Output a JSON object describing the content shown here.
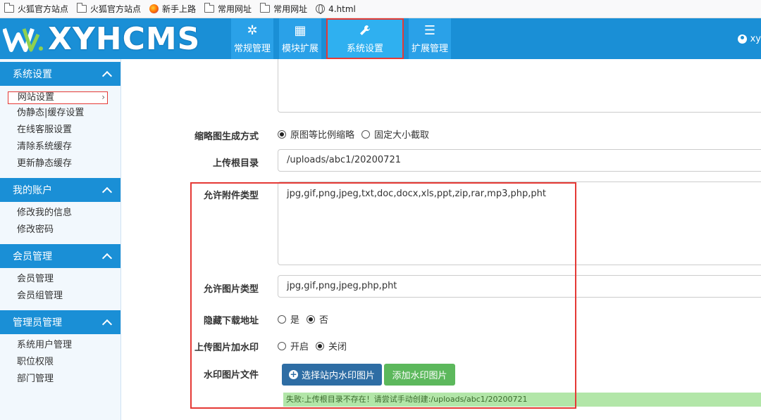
{
  "bookmarks": [
    {
      "label": "火狐官方站点",
      "icon": "folder-icon"
    },
    {
      "label": "火狐官方站点",
      "icon": "folder-icon"
    },
    {
      "label": "新手上路",
      "icon": "firefox-icon"
    },
    {
      "label": "常用网址",
      "icon": "folder-icon"
    },
    {
      "label": "常用网址",
      "icon": "folder-icon"
    },
    {
      "label": "4.html",
      "icon": "globe-icon"
    }
  ],
  "header": {
    "logo_text": "XYHCMS",
    "tabs": [
      {
        "label": "常规管理",
        "icon": "snowflake-icon"
      },
      {
        "label": "模块扩展",
        "icon": "grid-icon"
      },
      {
        "label": "系统设置",
        "icon": "wrench-icon"
      },
      {
        "label": "扩展管理",
        "icon": "list-icon"
      }
    ],
    "user": "xy"
  },
  "sidebar": {
    "sections": [
      {
        "title": "系统设置",
        "items": [
          "网站设置",
          "伪静态|缓存设置",
          "在线客服设置",
          "清除系统缓存",
          "更新静态缓存"
        ]
      },
      {
        "title": "我的账户",
        "items": [
          "修改我的信息",
          "修改密码"
        ]
      },
      {
        "title": "会员管理",
        "items": [
          "会员管理",
          "会员组管理"
        ]
      },
      {
        "title": "管理员管理",
        "items": [
          "系统用户管理",
          "职位权限",
          "部门管理"
        ]
      }
    ]
  },
  "form": {
    "thumb_label": "缩略图生成方式",
    "thumb_opt1": "原图等比例缩略",
    "thumb_opt2": "固定大小截取",
    "upload_root_label": "上传根目录",
    "upload_root_value": "/uploads/abc1/20200721",
    "attach_types_label": "允许附件类型",
    "attach_types_value": "jpg,gif,png,jpeg,txt,doc,docx,xls,ppt,zip,rar,mp3,php,pht",
    "image_types_label": "允许图片类型",
    "image_types_value": "jpg,gif,png,jpeg,php,pht",
    "hide_download_label": "隐藏下载地址",
    "hide_yes": "是",
    "hide_no": "否",
    "watermark_label": "上传图片加水印",
    "wm_on": "开启",
    "wm_off": "关闭",
    "watermark_file_label": "水印图片文件",
    "btn_select": "选择站内水印图片",
    "btn_add": "添加水印图片",
    "error_msg": "失败:上传根目录不存在！请尝试手动创建:/uploads/abc1/20200721"
  },
  "colors": {
    "header_blue": "#1a8fd6",
    "highlight_red": "#e53935",
    "alert_green": "#b2e6a8",
    "btn_blue": "#2e6da4",
    "btn_green": "#5cb85c"
  }
}
